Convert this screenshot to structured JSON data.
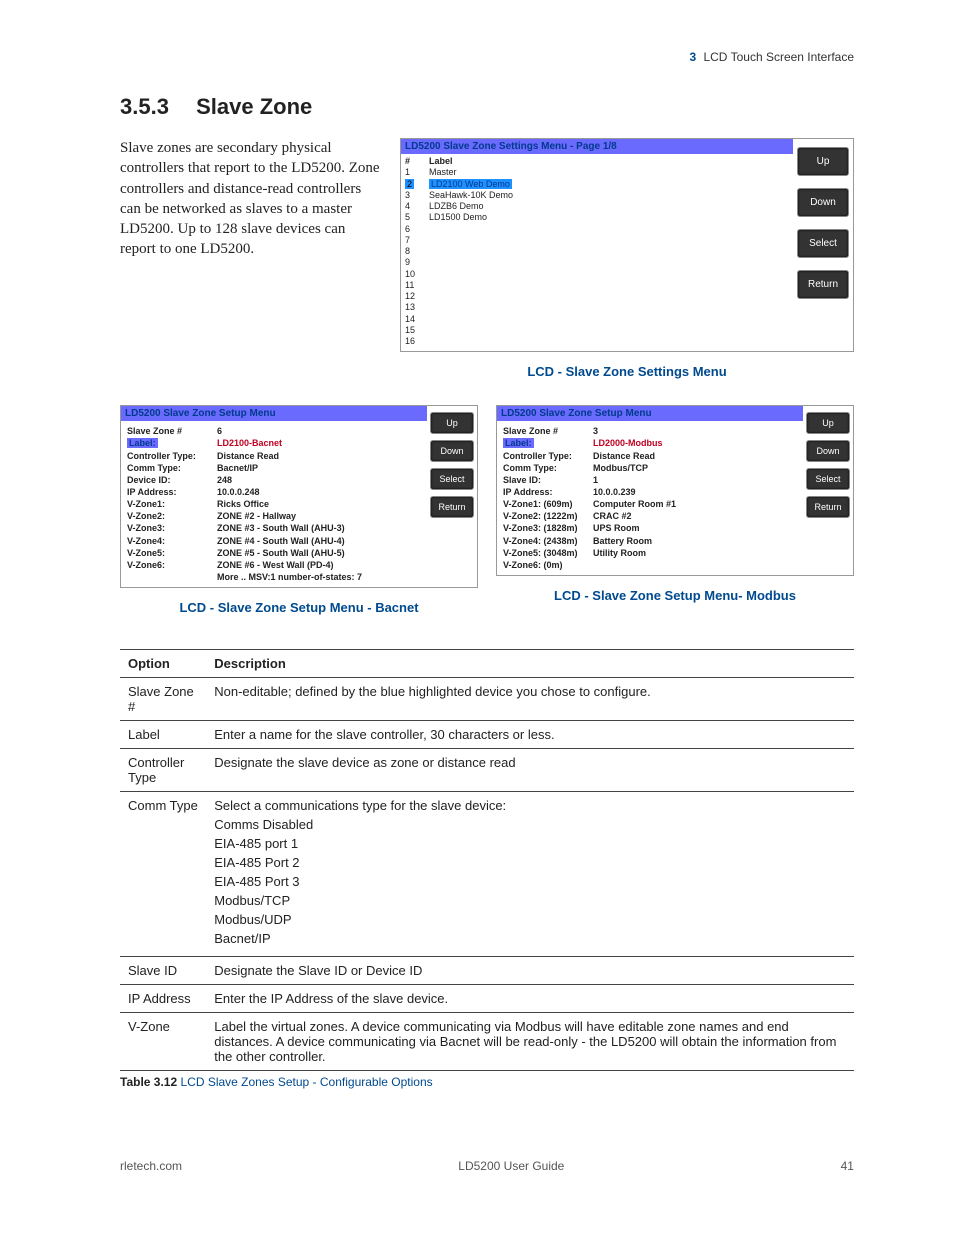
{
  "header": {
    "chapter_num": "3",
    "chapter_title": "LCD Touch Screen Interface"
  },
  "section": {
    "number": "3.5.3",
    "title": "Slave Zone"
  },
  "intro": "Slave zones are secondary physical controllers that report to the LD5200. Zone controllers and distance-read controllers can be networked as slaves to a master LD5200. Up to 128 slave devices can report to one LD5200.",
  "settings_menu": {
    "title": "LD5200 Slave Zone Settings Menu - Page 1/8",
    "header_num": "#",
    "header_label": "Label",
    "rows": [
      {
        "n": "1",
        "label": "Master"
      },
      {
        "n": "2",
        "label": "LD2100 Web Demo",
        "hl": true
      },
      {
        "n": "3",
        "label": "SeaHawk-10K Demo"
      },
      {
        "n": "4",
        "label": "LDZB6 Demo"
      },
      {
        "n": "5",
        "label": "LD1500 Demo"
      },
      {
        "n": "6",
        "label": ""
      },
      {
        "n": "7",
        "label": ""
      },
      {
        "n": "8",
        "label": ""
      },
      {
        "n": "9",
        "label": ""
      },
      {
        "n": "10",
        "label": ""
      },
      {
        "n": "11",
        "label": ""
      },
      {
        "n": "12",
        "label": ""
      },
      {
        "n": "13",
        "label": ""
      },
      {
        "n": "14",
        "label": ""
      },
      {
        "n": "15",
        "label": ""
      },
      {
        "n": "16",
        "label": ""
      }
    ],
    "buttons": [
      "Up",
      "Down",
      "Select",
      "Return"
    ],
    "caption": "LCD - Slave Zone Settings Menu"
  },
  "setup_bacnet": {
    "title": "LD5200 Slave Zone Setup Menu",
    "fields": [
      {
        "k": "Slave Zone #",
        "v": "6"
      },
      {
        "k": "Label:",
        "v": "LD2100-Bacnet",
        "hl": true
      },
      {
        "k": "Controller Type:",
        "v": "Distance Read"
      },
      {
        "k": "Comm Type:",
        "v": "Bacnet/IP"
      },
      {
        "k": "Device ID:",
        "v": "248"
      },
      {
        "k": "IP Address:",
        "v": "10.0.0.248"
      },
      {
        "k": "V-Zone1:",
        "v": "Ricks Office"
      },
      {
        "k": "V-Zone2:",
        "v": "ZONE #2 - Hallway"
      },
      {
        "k": "V-Zone3:",
        "v": "ZONE #3 - South Wall (AHU-3)"
      },
      {
        "k": "V-Zone4:",
        "v": "ZONE #4 - South Wall (AHU-4)"
      },
      {
        "k": "V-Zone5:",
        "v": "ZONE #5 - South Wall (AHU-5)"
      },
      {
        "k": "V-Zone6:",
        "v": "ZONE #6 - West Wall (PD-4)"
      }
    ],
    "more": "More .. MSV:1 number-of-states: 7",
    "buttons": [
      "Up",
      "Down",
      "Select",
      "Return"
    ],
    "caption": "LCD - Slave Zone Setup Menu - Bacnet"
  },
  "setup_modbus": {
    "title": "LD5200 Slave Zone Setup Menu",
    "fields": [
      {
        "k": "Slave Zone #",
        "v": "3"
      },
      {
        "k": "Label:",
        "v": "LD2000-Modbus",
        "hl": true
      },
      {
        "k": "Controller Type:",
        "v": "Distance Read"
      },
      {
        "k": "Comm Type:",
        "v": "Modbus/TCP"
      },
      {
        "k": "Slave ID:",
        "v": "1"
      },
      {
        "k": "IP Address:",
        "v": "10.0.0.239"
      },
      {
        "k": "V-Zone1: (609m)",
        "v": "Computer Room #1"
      },
      {
        "k": "V-Zone2: (1222m)",
        "v": "CRAC #2"
      },
      {
        "k": "V-Zone3: (1828m)",
        "v": "UPS Room"
      },
      {
        "k": "V-Zone4: (2438m)",
        "v": "Battery Room"
      },
      {
        "k": "V-Zone5: (3048m)",
        "v": "Utility Room"
      },
      {
        "k": "V-Zone6: (0m)",
        "v": ""
      }
    ],
    "buttons": [
      "Up",
      "Down",
      "Select",
      "Return"
    ],
    "caption": "LCD - Slave Zone Setup Menu- Modbus"
  },
  "table": {
    "head_option": "Option",
    "head_desc": "Description",
    "rows": [
      {
        "opt": "Slave Zone #",
        "desc": "Non-editable; defined by the blue highlighted device you chose to configure."
      },
      {
        "opt": "Label",
        "desc": "Enter a name for the slave controller, 30 characters or less."
      },
      {
        "opt": "Controller Type",
        "desc": "Designate the slave device as zone or distance read"
      },
      {
        "opt": "Comm Type",
        "desc_multi": [
          "Select a communications type for the slave device:",
          "Comms Disabled",
          "EIA-485 port 1",
          "EIA-485 Port 2",
          "EIA-485 Port 3",
          "Modbus/TCP",
          "Modbus/UDP",
          "Bacnet/IP"
        ]
      },
      {
        "opt": "Slave ID",
        "desc": "Designate the Slave ID or Device ID"
      },
      {
        "opt": "IP Address",
        "desc": "Enter the IP Address of the slave device."
      },
      {
        "opt": "V-Zone",
        "desc": "Label the virtual zones. A device communicating via Modbus will have editable zone names and end distances. A device communicating via Bacnet will be read-only - the LD5200 will obtain the information from the other controller."
      }
    ],
    "caption_label": "Table 3.12",
    "caption_text": "LCD Slave Zones Setup - Configurable Options"
  },
  "footer": {
    "left": "rletech.com",
    "center": "LD5200 User Guide",
    "right": "41"
  }
}
